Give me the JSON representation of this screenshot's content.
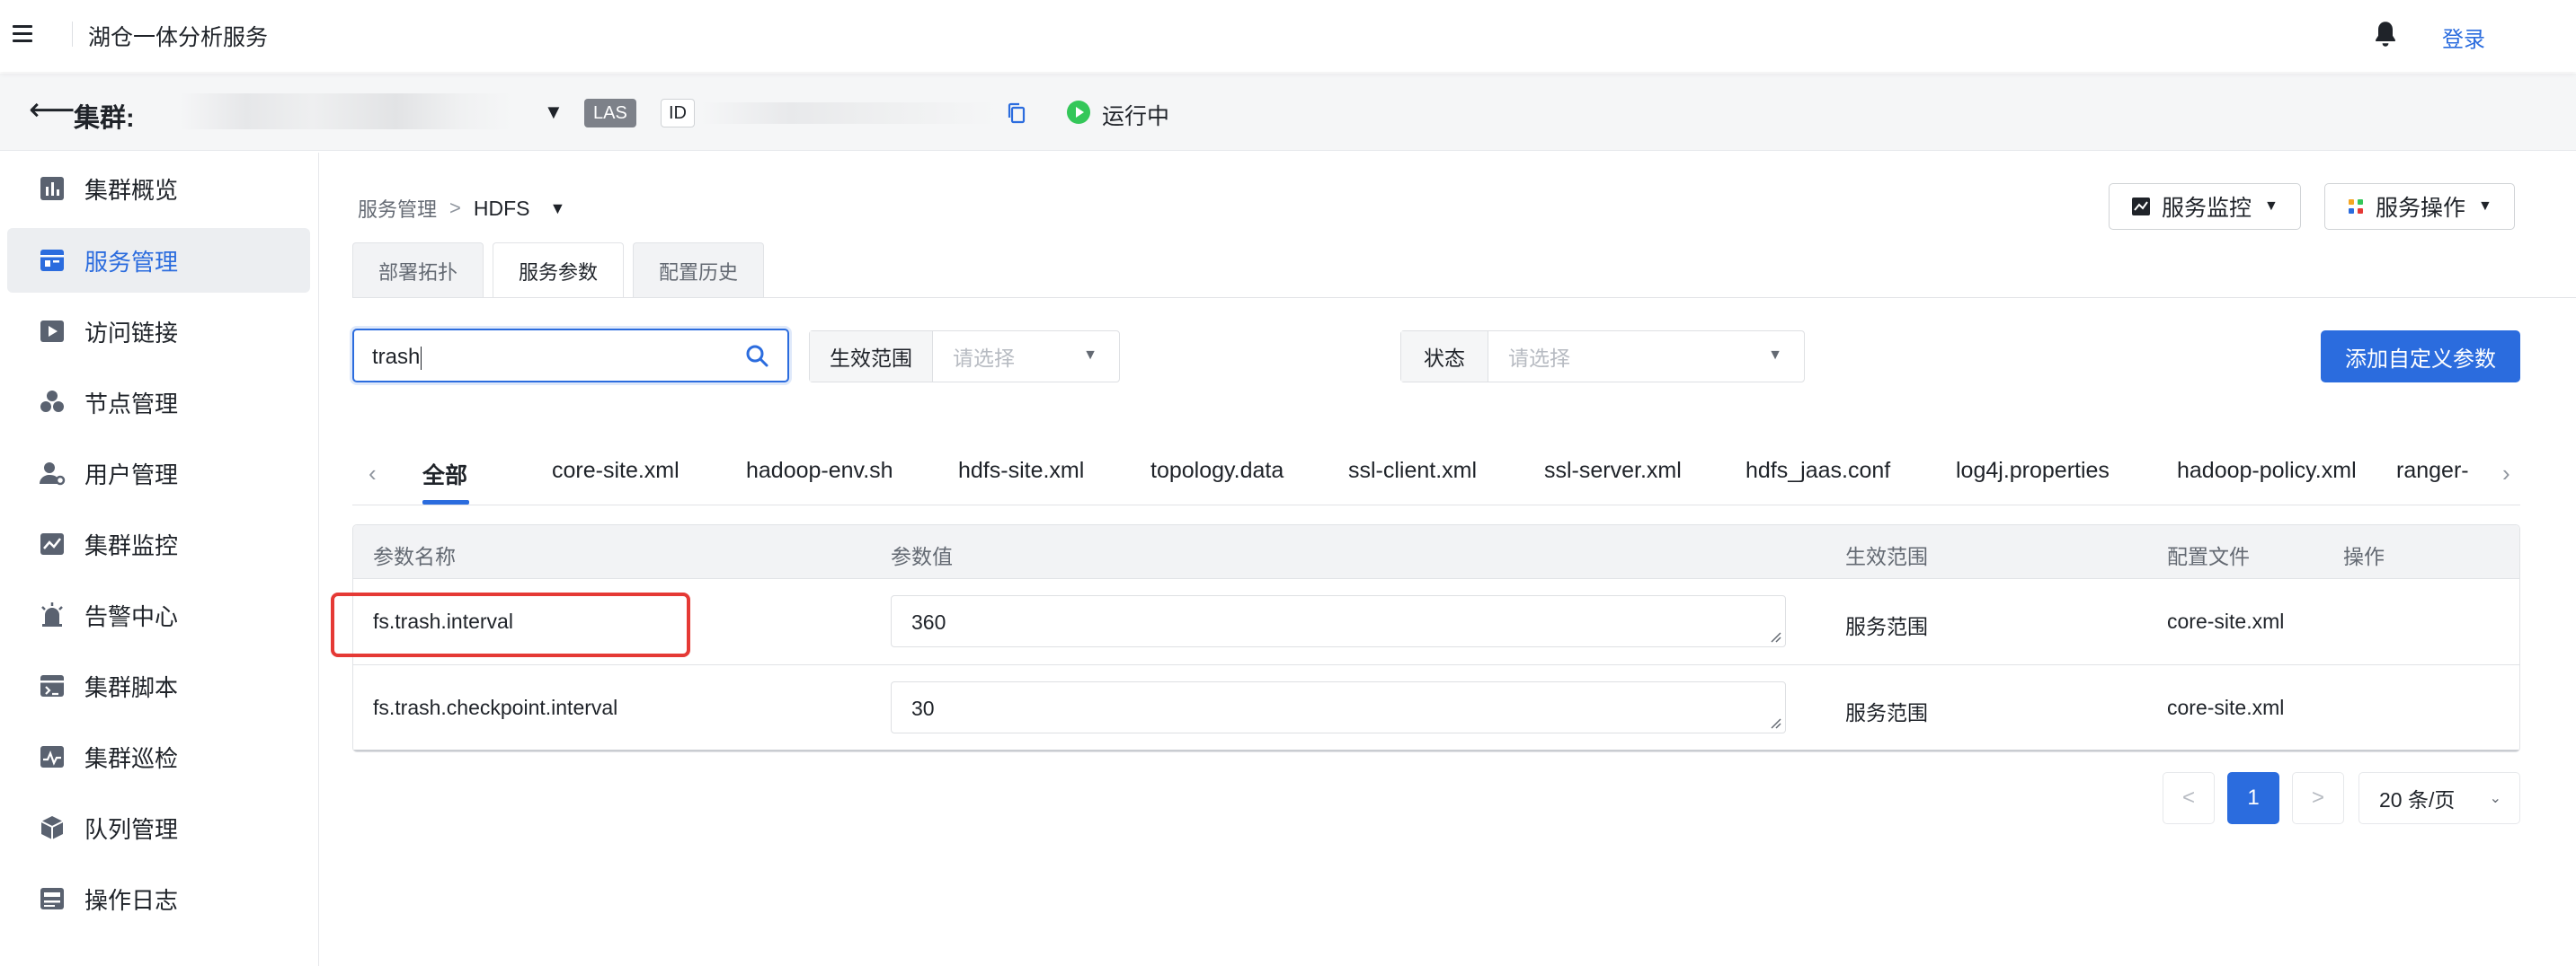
{
  "app": {
    "title": "湖仓一体分析服务",
    "login": "登录"
  },
  "cluster": {
    "label": "集群:",
    "engine_tag": "LAS",
    "id_label": "ID",
    "status": "运行中"
  },
  "sidebar": {
    "items": [
      {
        "label": "集群概览",
        "icon": "bar-chart-icon"
      },
      {
        "label": "服务管理",
        "icon": "service-icon"
      },
      {
        "label": "访问链接",
        "icon": "link-play-icon"
      },
      {
        "label": "节点管理",
        "icon": "nodes-icon"
      },
      {
        "label": "用户管理",
        "icon": "user-settings-icon"
      },
      {
        "label": "集群监控",
        "icon": "monitor-chart-icon"
      },
      {
        "label": "告警中心",
        "icon": "alarm-icon"
      },
      {
        "label": "集群脚本",
        "icon": "script-icon"
      },
      {
        "label": "集群巡检",
        "icon": "inspection-icon"
      },
      {
        "label": "队列管理",
        "icon": "queue-cube-icon"
      },
      {
        "label": "操作日志",
        "icon": "log-icon"
      }
    ],
    "active_index": 1
  },
  "breadcrumb": {
    "parent": "服务管理",
    "sep": ">",
    "current": "HDFS"
  },
  "header_buttons": {
    "monitor": "服务监控",
    "operate": "服务操作"
  },
  "tabs": [
    "部署拓扑",
    "服务参数",
    "配置历史"
  ],
  "active_tab": 1,
  "search": {
    "value": "trash"
  },
  "filters": {
    "scope": {
      "label": "生效范围",
      "placeholder": "请选择"
    },
    "status": {
      "label": "状态",
      "placeholder": "请选择"
    }
  },
  "add_button": "添加自定义参数",
  "file_tabs": [
    "全部",
    "core-site.xml",
    "hadoop-env.sh",
    "hdfs-site.xml",
    "topology.data",
    "ssl-client.xml",
    "ssl-server.xml",
    "hdfs_jaas.conf",
    "log4j.properties",
    "hadoop-policy.xml",
    "ranger-"
  ],
  "table": {
    "headers": [
      "参数名称",
      "参数值",
      "生效范围",
      "配置文件",
      "操作"
    ],
    "rows": [
      {
        "name": "fs.trash.interval",
        "value": "360",
        "scope": "服务范围",
        "file": "core-site.xml"
      },
      {
        "name": "fs.trash.checkpoint.interval",
        "value": "30",
        "scope": "服务范围",
        "file": "core-site.xml"
      }
    ]
  },
  "pagination": {
    "prev": "<",
    "current": "1",
    "next": ">",
    "page_size": "20 条/页"
  },
  "colors": {
    "primary": "#2b6cde",
    "running": "#34c759",
    "highlight": "#e53935",
    "engine_tag_bg": "#7d8189"
  }
}
